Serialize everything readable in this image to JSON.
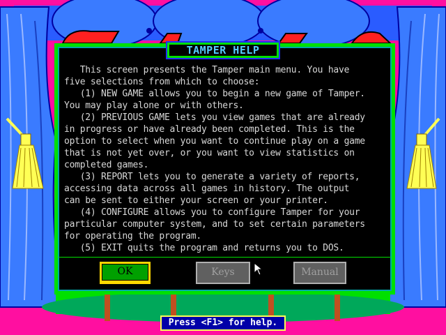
{
  "colors": {
    "background_magenta": "#ff0fa0",
    "curtain_blue": "#3a7bff",
    "panel_green": "#00e000",
    "panel_black": "#000000",
    "title_text": "#55ccff",
    "body_text": "#d8d8d8",
    "ok_yellow": "#ffd800",
    "status_blue": "#0000a8"
  },
  "dialog": {
    "title": "TAMPER HELP",
    "body": "   This screen presents the Tamper main menu. You have\nfive selections from which to choose:\n   (1) NEW GAME allows you to begin a new game of Tamper.\nYou may play alone or with others.\n   (2) PREVIOUS GAME lets you view games that are already\nin progress or have already been completed. This is the\noption to select when you want to continue play on a game\nthat is not yet over, or you want to view statistics on\ncompleted games.\n   (3) REPORT lets you to generate a variety of reports,\naccessing data across all games in history. The output\ncan be sent to either your screen or your printer.\n   (4) CONFIGURE allows you to configure Tamper for your\nparticular computer system, and to set certain parameters\nfor operating the program.\n   (5) EXIT quits the program and returns you to DOS.",
    "buttons": {
      "ok": "OK",
      "keys": "Keys",
      "manual": "Manual"
    }
  },
  "status_bar": {
    "text": "Press <F1> for help."
  },
  "icons": {
    "cursor": "arrow-pointer-icon",
    "tassel_left": "tassel-icon",
    "tassel_right": "tassel-icon"
  }
}
